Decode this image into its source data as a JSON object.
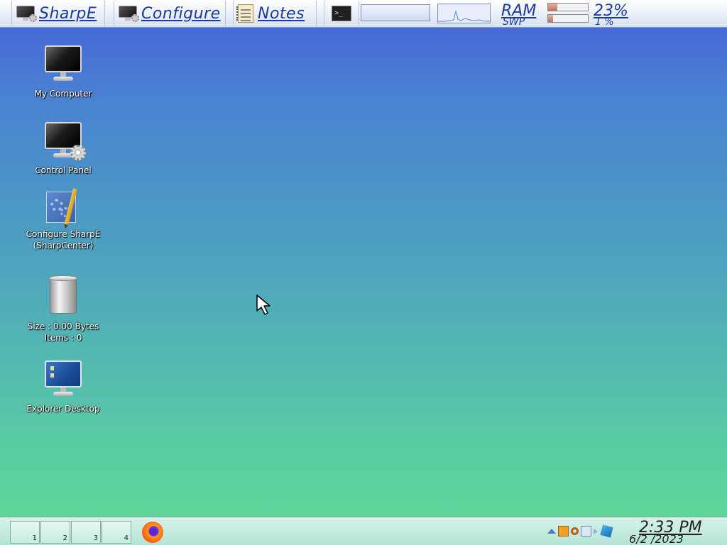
{
  "topbar": {
    "sharpe_label": "SharpE",
    "configure_label": "Configure",
    "notes_label": "Notes",
    "terminal_glyph": ">_",
    "ram_label": "RAM",
    "swap_label": "SWP",
    "ram_percent": "23%",
    "swap_percent": "1 %",
    "ram_usage": 0.23,
    "swap_usage": 0.12
  },
  "desktop": {
    "my_computer": "My Computer",
    "control_panel": "Control Panel",
    "configure_line1": "Configure SharpE",
    "configure_line2": "(SharpCenter)",
    "recycle_size": "Size : 0.00 Bytes",
    "recycle_items": "Items : 0",
    "explorer_desktop": "Explorer Desktop"
  },
  "taskbar": {
    "workspaces": [
      "1",
      "2",
      "3",
      "4"
    ],
    "clock": "2:33 PM",
    "date": "6/2 /2023"
  },
  "colors": {
    "accent_text": "#1a3aa0",
    "desktop_top": "#4560d8",
    "desktop_bottom": "#62d896"
  }
}
